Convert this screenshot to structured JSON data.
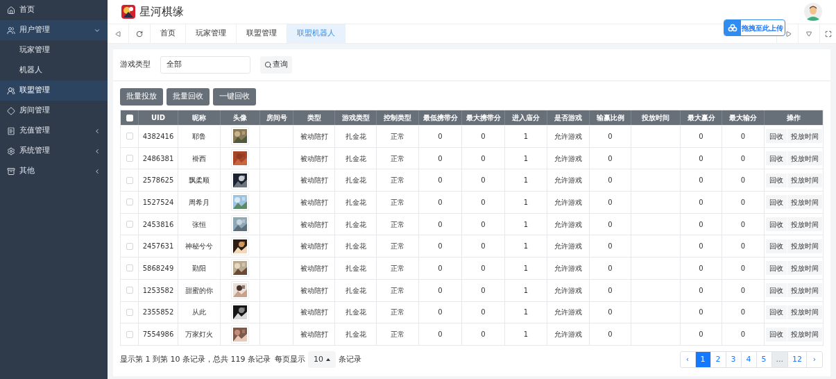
{
  "sidebar": {
    "items": [
      {
        "label": "首页",
        "selected": false
      },
      {
        "label": "用户管理",
        "selected": false,
        "expanded": true,
        "children": [
          {
            "label": "玩家管理",
            "selected": false
          },
          {
            "label": "机器人",
            "selected": false
          }
        ]
      },
      {
        "label": "联盟管理",
        "selected": true
      },
      {
        "label": "房间管理",
        "selected": false
      },
      {
        "label": "充值管理",
        "selected": false,
        "expanded": false
      },
      {
        "label": "系统管理",
        "selected": false,
        "expanded": false
      },
      {
        "label": "其他",
        "selected": false,
        "expanded": false
      }
    ]
  },
  "header": {
    "title": "星河棋缘"
  },
  "tabs": [
    {
      "label": "首页",
      "selected": false
    },
    {
      "label": "玩家管理",
      "selected": false
    },
    {
      "label": "联盟管理",
      "selected": false
    },
    {
      "label": "联盟机器人",
      "selected": true
    }
  ],
  "upload_widget": {
    "label": "拖拽至此上传"
  },
  "filter": {
    "label": "游戏类型",
    "value": "全部",
    "button": "查询"
  },
  "actions": [
    "批量投放",
    "批量回收",
    "一键回收"
  ],
  "table": {
    "header_checked": false,
    "columns": [
      "UID",
      "昵称",
      "头像",
      "房间号",
      "类型",
      "游戏类型",
      "控制类型",
      "最低携带分",
      "最大携带分",
      "进入庙分",
      "是否游戏",
      "输赢比例",
      "投放时间",
      "最大赢分",
      "最大输分",
      "操作"
    ],
    "rows": [
      {
        "checked": false,
        "uid": "4382416",
        "name": "耶鲁",
        "type": "被动陪打",
        "game": "扎金花",
        "control": "正常",
        "min": "0",
        "max": "0",
        "enter": "1",
        "playing": "允许游戏",
        "ratio": "0",
        "win": "0",
        "lose": "0",
        "actions": [
          "回收",
          "投放时间"
        ]
      },
      {
        "checked": false,
        "uid": "2486381",
        "name": "褂西",
        "type": "被动陪打",
        "game": "扎金花",
        "control": "正常",
        "min": "0",
        "max": "0",
        "enter": "1",
        "playing": "允许游戏",
        "ratio": "0",
        "win": "0",
        "lose": "0",
        "actions": [
          "回收",
          "投放时间"
        ]
      },
      {
        "checked": false,
        "uid": "2578625",
        "name": "飘柔顺",
        "type": "被动陪打",
        "game": "扎金花",
        "control": "正常",
        "min": "0",
        "max": "0",
        "enter": "1",
        "playing": "允许游戏",
        "ratio": "0",
        "win": "0",
        "lose": "0",
        "actions": [
          "回收",
          "投放时间"
        ]
      },
      {
        "checked": false,
        "uid": "1527524",
        "name": "周希月",
        "type": "被动陪打",
        "game": "扎金花",
        "control": "正常",
        "min": "0",
        "max": "0",
        "enter": "1",
        "playing": "允许游戏",
        "ratio": "0",
        "win": "0",
        "lose": "0",
        "actions": [
          "回收",
          "投放时间"
        ]
      },
      {
        "checked": false,
        "uid": "2453816",
        "name": "张恒",
        "type": "被动陪打",
        "game": "扎金花",
        "control": "正常",
        "min": "0",
        "max": "0",
        "enter": "1",
        "playing": "允许游戏",
        "ratio": "0",
        "win": "0",
        "lose": "0",
        "actions": [
          "回收",
          "投放时间"
        ]
      },
      {
        "checked": false,
        "uid": "2457631",
        "name": "神秘兮兮",
        "type": "被动陪打",
        "game": "扎金花",
        "control": "正常",
        "min": "0",
        "max": "0",
        "enter": "1",
        "playing": "允许游戏",
        "ratio": "0",
        "win": "0",
        "lose": "0",
        "actions": [
          "回收",
          "投放时间"
        ]
      },
      {
        "checked": false,
        "uid": "5868249",
        "name": "勤阳",
        "type": "被动陪打",
        "game": "扎金花",
        "control": "正常",
        "min": "0",
        "max": "0",
        "enter": "1",
        "playing": "允许游戏",
        "ratio": "0",
        "win": "0",
        "lose": "0",
        "actions": [
          "回收",
          "投放时间"
        ]
      },
      {
        "checked": false,
        "uid": "1253582",
        "name": "甜蜜的你",
        "type": "被动陪打",
        "game": "扎金花",
        "control": "正常",
        "min": "0",
        "max": "0",
        "enter": "1",
        "playing": "允许游戏",
        "ratio": "0",
        "win": "0",
        "lose": "0",
        "actions": [
          "回收",
          "投放时间"
        ]
      },
      {
        "checked": false,
        "uid": "2355852",
        "name": "从此",
        "type": "被动陪打",
        "game": "扎金花",
        "control": "正常",
        "min": "0",
        "max": "0",
        "enter": "1",
        "playing": "允许游戏",
        "ratio": "0",
        "win": "0",
        "lose": "0",
        "actions": [
          "回收",
          "投放时间"
        ]
      },
      {
        "checked": false,
        "uid": "7554986",
        "name": "万家灯火",
        "type": "被动陪打",
        "game": "扎金花",
        "control": "正常",
        "min": "0",
        "max": "0",
        "enter": "1",
        "playing": "允许游戏",
        "ratio": "0",
        "win": "0",
        "lose": "0",
        "actions": [
          "回收",
          "投放时间"
        ]
      }
    ]
  },
  "footer": {
    "summary": "显示第 1 到第 10 条记录，总共 119 条记录",
    "per_page_label": "每页显示",
    "per_page": "10",
    "per_page_suffix": "条记录"
  },
  "pagination": {
    "prev": "‹",
    "next": "›",
    "pages": [
      {
        "label": "1",
        "selected": true
      },
      {
        "label": "2",
        "selected": false
      },
      {
        "label": "3",
        "selected": false
      },
      {
        "label": "4",
        "selected": false
      },
      {
        "label": "5",
        "selected": false
      },
      {
        "label": "...",
        "selected": false,
        "kind": "gap"
      },
      {
        "label": "12",
        "selected": false
      }
    ]
  }
}
